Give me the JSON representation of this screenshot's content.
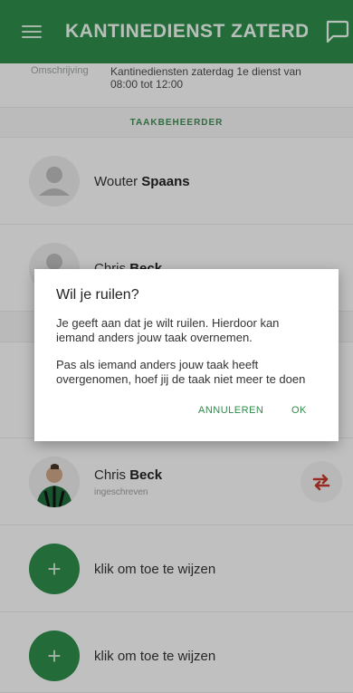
{
  "appbar": {
    "title": "KANTINEDIENST ZATERD...",
    "menu_icon": "hamburger-icon",
    "chat_icon": "chat-bubble-icon",
    "color": "#2e8b4a"
  },
  "description": {
    "label": "Omschrijving",
    "text_line1": "Kantinediensten zaterdag 1e dienst van",
    "text_line2": "08:00 tot 12:00"
  },
  "section": {
    "label": "TAAKBEHEERDER"
  },
  "people": [
    {
      "first": "Wouter",
      "last": "Spaans"
    },
    {
      "first": "Chris",
      "last": "Beck"
    }
  ],
  "member": {
    "first": "Chris",
    "last": "Beck",
    "status": "ingeschreven"
  },
  "assign_rows": [
    {
      "label": "klik om toe te wijzen"
    },
    {
      "label": "klik om toe te wijzen"
    }
  ],
  "dialog": {
    "title": "Wil je ruilen?",
    "body_line1": "Je geeft aan dat je wilt ruilen. Hierdoor kan",
    "body_line2": "iemand anders jouw taak overnemen.",
    "body_line3": "Pas als iemand anders jouw taak heeft",
    "body_line4": "overgenomen, hoef jij de taak niet meer te doen",
    "cancel_label": "ANNULEREN",
    "ok_label": "OK"
  }
}
